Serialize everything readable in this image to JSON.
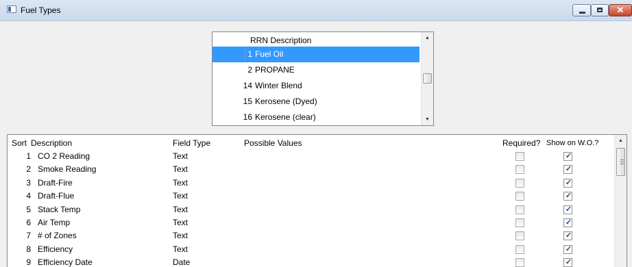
{
  "window": {
    "title": "Fuel Types",
    "icon": "window-app-icon",
    "close_glyph": "✕"
  },
  "fuel_list": {
    "header": "RRN Description",
    "rows": [
      {
        "rrn": "1",
        "description": "Fuel Oil",
        "selected": true
      },
      {
        "rrn": "2",
        "description": "PROPANE",
        "selected": false
      },
      {
        "rrn": "14",
        "description": "Winter Blend",
        "selected": false
      },
      {
        "rrn": "15",
        "description": "Kerosene (Dyed)",
        "selected": false
      },
      {
        "rrn": "16",
        "description": "Kerosene (clear)",
        "selected": false
      }
    ],
    "up_arrow": "▲",
    "down_arrow": "▼"
  },
  "fields_grid": {
    "headers": {
      "sort": "Sort",
      "description": "Description",
      "field_type": "Field Type",
      "possible_values": "Possible Values",
      "required": "Required?",
      "show_on_wo": "Show on W.O.?"
    },
    "rows": [
      {
        "sort": "1",
        "description": "CO 2 Reading",
        "field_type": "Text",
        "possible_values": "",
        "required": false,
        "show_on_wo": true
      },
      {
        "sort": "2",
        "description": "Smoke Reading",
        "field_type": "Text",
        "possible_values": "",
        "required": false,
        "show_on_wo": true
      },
      {
        "sort": "3",
        "description": "Draft-Fire",
        "field_type": "Text",
        "possible_values": "",
        "required": false,
        "show_on_wo": true
      },
      {
        "sort": "4",
        "description": "Draft-Flue",
        "field_type": "Text",
        "possible_values": "",
        "required": false,
        "show_on_wo": true
      },
      {
        "sort": "5",
        "description": "Stack Temp",
        "field_type": "Text",
        "possible_values": "",
        "required": false,
        "show_on_wo": true
      },
      {
        "sort": "6",
        "description": "Air Temp",
        "field_type": "Text",
        "possible_values": "",
        "required": false,
        "show_on_wo": true
      },
      {
        "sort": "7",
        "description": "# of Zones",
        "field_type": "Text",
        "possible_values": "",
        "required": false,
        "show_on_wo": true
      },
      {
        "sort": "8",
        "description": "Efficiency",
        "field_type": "Text",
        "possible_values": "",
        "required": false,
        "show_on_wo": true
      },
      {
        "sort": "9",
        "description": "Efficiency Date",
        "field_type": "Date",
        "possible_values": "",
        "required": false,
        "show_on_wo": true
      }
    ],
    "check_glyph": "✓",
    "up_arrow": "▲"
  },
  "colors": {
    "selection": "#3399ff",
    "title_bar": "#c9d9ec",
    "close_button": "#c7442b"
  }
}
